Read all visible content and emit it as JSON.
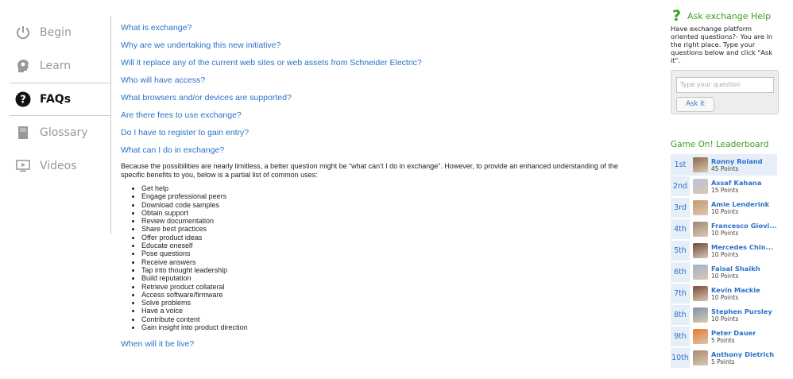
{
  "nav": {
    "items": [
      {
        "label": "Begin",
        "icon": "power-icon"
      },
      {
        "label": "Learn",
        "icon": "head-gear-icon"
      },
      {
        "label": "FAQs",
        "icon": "question-circle-icon",
        "active": true
      },
      {
        "label": "Glossary",
        "icon": "book-icon"
      },
      {
        "label": "Videos",
        "icon": "monitor-play-icon"
      }
    ]
  },
  "faq": {
    "questions": [
      "What is exchange?",
      "Why are we undertaking this new initiative?",
      "Will it replace any of the current web sites or web assets from Schneider Electric?",
      "Who will have access?",
      "What browsers and/or devices are supported?",
      "Are there fees to use exchange?",
      "Do I have to register to gain entry?",
      "What can I do in exchange?"
    ],
    "answer_intro": "Because the possibilities are nearly limitless, a better question might be “what can’t I do in exchange”. However, to provide an enhanced understanding of the specific benefits to you, below is a partial list of common uses:",
    "answer_list": [
      "Get help",
      "Engage professional peers",
      "Download code samples",
      "Obtain support",
      "Review documentation",
      "Share best practices",
      "Offer product ideas",
      "Educate oneself",
      "Pose questions",
      "Receive answers",
      "Tap into thought leadership",
      "Build reputation",
      "Retrieve product collateral",
      "Access software/firmware",
      "Solve problems",
      "Have a voice",
      "Contribute content",
      "Gain insight into product direction"
    ],
    "last_question": "When will it be live?"
  },
  "help": {
    "title": "Ask exchange Help",
    "description": "Have exchange platform oriented questions?- You are in the right place. Type your questions below and click \"Ask it\".",
    "placeholder": "Type your question",
    "button_label": "Ask it"
  },
  "leaderboard": {
    "title": "Game On! Leaderboard",
    "accent_color": "#3aa01c",
    "entries": [
      {
        "rank": "1st",
        "name": "Ronny Roland",
        "points": "45 Points",
        "avatar_color": "#8a6a4f"
      },
      {
        "rank": "2nd",
        "name": "Assaf Kahana",
        "points": "15 Points",
        "avatar_color": "#b9c3d6"
      },
      {
        "rank": "3rd",
        "name": "Amie Lenderink",
        "points": "10 Points",
        "avatar_color": "#c79a6e"
      },
      {
        "rank": "4th",
        "name": "Francesco Giovi...",
        "points": "10 Points",
        "avatar_color": "#9c8a74"
      },
      {
        "rank": "5th",
        "name": "Mercedes Chin...",
        "points": "10 Points",
        "avatar_color": "#6b4a3a"
      },
      {
        "rank": "6th",
        "name": "Faisal Shaikh",
        "points": "10 Points",
        "avatar_color": "#9fb3c8"
      },
      {
        "rank": "7th",
        "name": "Kevin Mackie",
        "points": "10 Points",
        "avatar_color": "#7a4a3a"
      },
      {
        "rank": "8th",
        "name": "Stephen Pursley",
        "points": "10 Points",
        "avatar_color": "#8094a8"
      },
      {
        "rank": "9th",
        "name": "Peter Dauer",
        "points": "5 Points",
        "avatar_color": "#e8792a"
      },
      {
        "rank": "10th",
        "name": "Anthony Dietrich",
        "points": "5 Points",
        "avatar_color": "#a88a70"
      }
    ]
  }
}
